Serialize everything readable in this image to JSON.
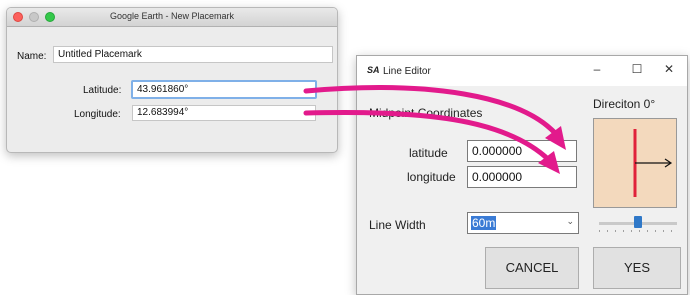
{
  "google_earth": {
    "title": "Google Earth - New Placemark",
    "name_label": "Name:",
    "name_value": "Untitled Placemark",
    "latitude_label": "Latitude:",
    "latitude_value": "43.961860°",
    "longitude_label": "Longitude:",
    "longitude_value": "12.683994°"
  },
  "line_editor": {
    "app_icon": "SA",
    "title": "Line Editor",
    "minimize": "–",
    "maximize": "☐",
    "close": "✕",
    "midpoint_heading": "Midpoint Coordinates",
    "latitude_label": "latitude",
    "latitude_value": "0.000000",
    "longitude_label": "longitude",
    "longitude_value": "0.000000",
    "line_width_label": "Line Width",
    "line_width_value": "60m",
    "direction_label": "Direciton 0°",
    "direction_slider_value": 0.5,
    "cancel_label": "CANCEL",
    "yes_label": "YES"
  },
  "colors": {
    "arrow": "#e21a8c",
    "direction_line": "#e0223a",
    "direction_bg": "#f3d9bd"
  }
}
